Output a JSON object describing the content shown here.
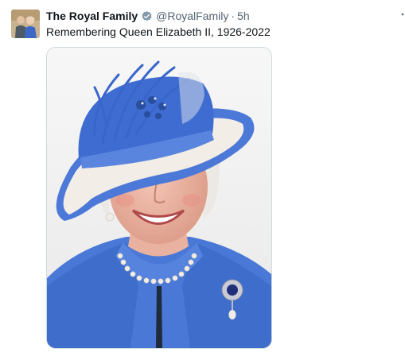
{
  "tweet": {
    "display_name": "The Royal Family",
    "handle": "@RoyalFamily",
    "separator": "·",
    "time": "5h",
    "text": "Remembering Queen Elizabeth II, 1926-2022",
    "more_icon": "more-icon",
    "verified_icon": "verified-badge-icon",
    "media_alt": "Portrait photo of Queen Elizabeth II in a blue hat and coat"
  },
  "colors": {
    "text_primary": "#0f1419",
    "text_secondary": "#536471",
    "verified_gray": "#829aab",
    "coat_blue": "#4a78d6"
  }
}
